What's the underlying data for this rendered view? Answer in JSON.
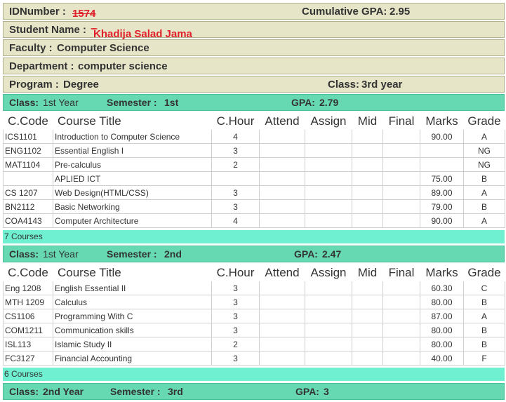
{
  "student": {
    "id_label": "IDNumber :",
    "id_value": "1574",
    "cgpa_label": "Cumulative GPA:",
    "cgpa_value": "2.95",
    "name_label": "Student Name :",
    "name_value": "Khadija Salad Jama",
    "faculty_label": "Faculty :",
    "faculty_value": "Computer Science",
    "department_label": "Department :",
    "department_value": "computer science",
    "program_label": "Program :",
    "program_value": "Degree",
    "class_label": "Class:",
    "class_value": "3rd year"
  },
  "headers": [
    "C.Code",
    "Course Title",
    "C.Hour",
    "Attend",
    "Assign",
    "Mid",
    "Final",
    "Marks",
    "Grade"
  ],
  "semesters": [
    {
      "class_label": "Class:",
      "class_value": "1st Year",
      "semester_label": "Semester :",
      "semester_value": "1st",
      "gpa_label": "GPA:",
      "gpa_value": "2.79",
      "courses_count": "7 Courses",
      "courses": [
        {
          "code": "ICS1101",
          "title": "Introduction to Computer Science",
          "hour": "4",
          "attend": "",
          "assign": "",
          "mid": "",
          "final": "",
          "marks": "90.00",
          "grade": "A"
        },
        {
          "code": "ENG1102",
          "title": "Essential English I",
          "hour": "3",
          "attend": "",
          "assign": "",
          "mid": "",
          "final": "",
          "marks": "",
          "grade": "NG"
        },
        {
          "code": "MAT1104",
          "title": "Pre-calculus",
          "hour": "2",
          "attend": "",
          "assign": "",
          "mid": "",
          "final": "",
          "marks": "",
          "grade": "NG"
        },
        {
          "code": "",
          "title": "APLIED ICT",
          "hour": "",
          "attend": "",
          "assign": "",
          "mid": "",
          "final": "",
          "marks": "75.00",
          "grade": "B"
        },
        {
          "code": "CS 1207",
          "title": "Web Design(HTML/CSS)",
          "hour": "3",
          "attend": "",
          "assign": "",
          "mid": "",
          "final": "",
          "marks": "89.00",
          "grade": "A"
        },
        {
          "code": "BN2112",
          "title": "Basic Networking",
          "hour": "3",
          "attend": "",
          "assign": "",
          "mid": "",
          "final": "",
          "marks": "79.00",
          "grade": "B"
        },
        {
          "code": "COA4143",
          "title": "Computer Architecture",
          "hour": "4",
          "attend": "",
          "assign": "",
          "mid": "",
          "final": "",
          "marks": "90.00",
          "grade": "A"
        }
      ]
    },
    {
      "class_label": "Class:",
      "class_value": "1st Year",
      "semester_label": "Semester :",
      "semester_value": "2nd",
      "gpa_label": "GPA:",
      "gpa_value": "2.47",
      "courses_count": "6 Courses",
      "courses": [
        {
          "code": "Eng 1208",
          "title": "English Essential II",
          "hour": "3",
          "attend": "",
          "assign": "",
          "mid": "",
          "final": "",
          "marks": "60.30",
          "grade": "C"
        },
        {
          "code": "MTH 1209",
          "title": "Calculus",
          "hour": "3",
          "attend": "",
          "assign": "",
          "mid": "",
          "final": "",
          "marks": "80.00",
          "grade": "B"
        },
        {
          "code": "CS1106",
          "title": "Programming With C",
          "hour": "3",
          "attend": "",
          "assign": "",
          "mid": "",
          "final": "",
          "marks": "87.00",
          "grade": "A"
        },
        {
          "code": "COM1211",
          "title": "Communication skills",
          "hour": "3",
          "attend": "",
          "assign": "",
          "mid": "",
          "final": "",
          "marks": "80.00",
          "grade": "B"
        },
        {
          "code": "ISL113",
          "title": "Islamic Study II",
          "hour": "2",
          "attend": "",
          "assign": "",
          "mid": "",
          "final": "",
          "marks": "80.00",
          "grade": "B"
        },
        {
          "code": "FC3127",
          "title": "Financial Accounting",
          "hour": "3",
          "attend": "",
          "assign": "",
          "mid": "",
          "final": "",
          "marks": "40.00",
          "grade": "F"
        }
      ]
    },
    {
      "class_label": "Class:",
      "class_value": "2nd Year",
      "semester_label": "Semester :",
      "semester_value": "3rd",
      "gpa_label": "GPA:",
      "gpa_value": "3"
    }
  ],
  "colors": {
    "info_bg": "#e6e5c8",
    "class_bar_bg": "#66d9b3",
    "courses_bar_bg": "#6ff0d0",
    "redaction": "#e0202a"
  }
}
